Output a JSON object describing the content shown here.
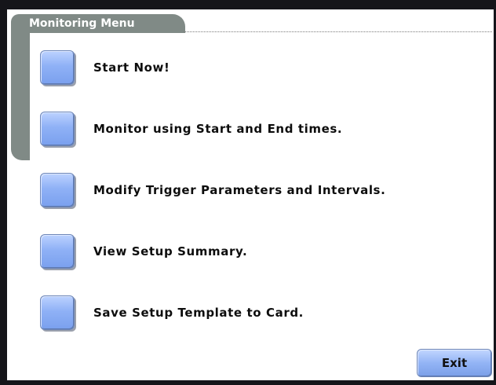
{
  "header": {
    "title": "Monitoring Menu"
  },
  "menu": {
    "items": [
      {
        "label": "Start Now!"
      },
      {
        "label": "Monitor using Start and End times."
      },
      {
        "label": "Modify Trigger Parameters and Intervals."
      },
      {
        "label": "View Setup Summary."
      },
      {
        "label": "Save Setup Template to Card."
      }
    ]
  },
  "footer": {
    "exit_label": "Exit"
  },
  "colors": {
    "tab": "#808a86",
    "button": "#8fb1f6",
    "background": "#ffffff"
  }
}
